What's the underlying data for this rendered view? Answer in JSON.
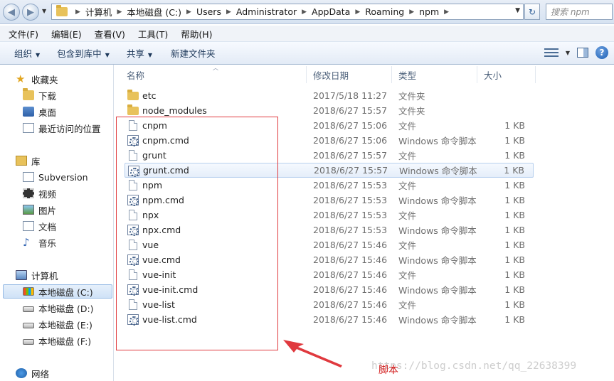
{
  "address_bar": {
    "breadcrumbs": [
      "计算机",
      "本地磁盘 (C:)",
      "Users",
      "Administrator",
      "AppData",
      "Roaming",
      "npm"
    ],
    "search_placeholder": "搜索 npm"
  },
  "menu": [
    "文件(F)",
    "编辑(E)",
    "查看(V)",
    "工具(T)",
    "帮助(H)"
  ],
  "toolbar": {
    "organize": "组织",
    "include_in_library": "包含到库中",
    "share": "共享",
    "new_folder": "新建文件夹"
  },
  "navigation": {
    "favorites": {
      "label": "收藏夹",
      "items": [
        "下载",
        "桌面",
        "最近访问的位置"
      ]
    },
    "libraries": {
      "label": "库",
      "items": [
        "Subversion",
        "视频",
        "图片",
        "文档",
        "音乐"
      ]
    },
    "computer": {
      "label": "计算机",
      "items": [
        "本地磁盘 (C:)",
        "本地磁盘 (D:)",
        "本地磁盘 (E:)",
        "本地磁盘 (F:)"
      ]
    },
    "network": {
      "label": "网络"
    }
  },
  "columns": {
    "name": "名称",
    "date": "修改日期",
    "type": "类型",
    "size": "大小"
  },
  "files": [
    {
      "name": "etc",
      "date": "2017/5/18 11:27",
      "type": "文件夹",
      "size": "",
      "icon": "folder-icon"
    },
    {
      "name": "node_modules",
      "date": "2018/6/27 15:57",
      "type": "文件夹",
      "size": "",
      "icon": "folder-icon"
    },
    {
      "name": "cnpm",
      "date": "2018/6/27 15:06",
      "type": "文件",
      "size": "1 KB",
      "icon": "file-icon"
    },
    {
      "name": "cnpm.cmd",
      "date": "2018/6/27 15:06",
      "type": "Windows 命令脚本",
      "size": "1 KB",
      "icon": "cmd-script-icon"
    },
    {
      "name": "grunt",
      "date": "2018/6/27 15:57",
      "type": "文件",
      "size": "1 KB",
      "icon": "file-icon"
    },
    {
      "name": "grunt.cmd",
      "date": "2018/6/27 15:57",
      "type": "Windows 命令脚本",
      "size": "1 KB",
      "icon": "cmd-script-icon"
    },
    {
      "name": "npm",
      "date": "2018/6/27 15:53",
      "type": "文件",
      "size": "1 KB",
      "icon": "file-icon"
    },
    {
      "name": "npm.cmd",
      "date": "2018/6/27 15:53",
      "type": "Windows 命令脚本",
      "size": "1 KB",
      "icon": "cmd-script-icon"
    },
    {
      "name": "npx",
      "date": "2018/6/27 15:53",
      "type": "文件",
      "size": "1 KB",
      "icon": "file-icon"
    },
    {
      "name": "npx.cmd",
      "date": "2018/6/27 15:53",
      "type": "Windows 命令脚本",
      "size": "1 KB",
      "icon": "cmd-script-icon"
    },
    {
      "name": "vue",
      "date": "2018/6/27 15:46",
      "type": "文件",
      "size": "1 KB",
      "icon": "file-icon"
    },
    {
      "name": "vue.cmd",
      "date": "2018/6/27 15:46",
      "type": "Windows 命令脚本",
      "size": "1 KB",
      "icon": "cmd-script-icon"
    },
    {
      "name": "vue-init",
      "date": "2018/6/27 15:46",
      "type": "文件",
      "size": "1 KB",
      "icon": "file-icon"
    },
    {
      "name": "vue-init.cmd",
      "date": "2018/6/27 15:46",
      "type": "Windows 命令脚本",
      "size": "1 KB",
      "icon": "cmd-script-icon"
    },
    {
      "name": "vue-list",
      "date": "2018/6/27 15:46",
      "type": "文件",
      "size": "1 KB",
      "icon": "file-icon"
    },
    {
      "name": "vue-list.cmd",
      "date": "2018/6/27 15:46",
      "type": "Windows 命令脚本",
      "size": "1 KB",
      "icon": "cmd-script-icon"
    }
  ],
  "annotation": {
    "label": "脚本",
    "color": "#e0393e"
  },
  "watermark": "https://blog.csdn.net/qq_22638399"
}
